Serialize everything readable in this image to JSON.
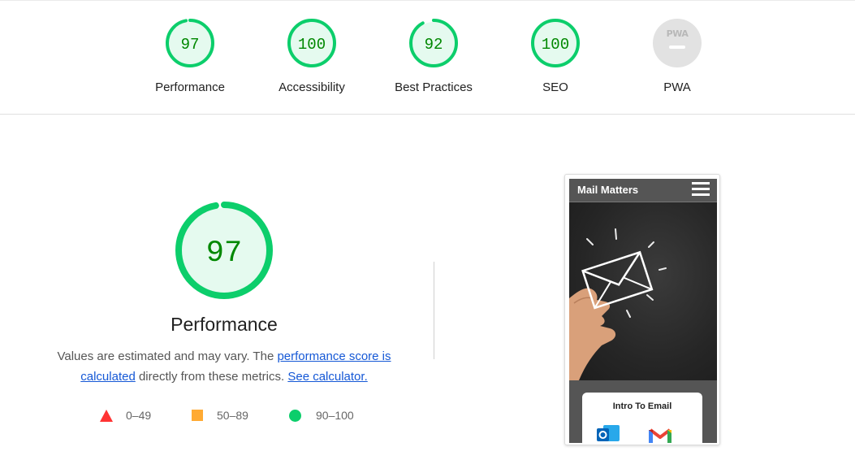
{
  "categories": [
    {
      "label": "Performance",
      "score": "97",
      "score_fraction": 0.97
    },
    {
      "label": "Accessibility",
      "score": "100",
      "score_fraction": 1.0
    },
    {
      "label": "Best Practices",
      "score": "92",
      "score_fraction": 0.92
    },
    {
      "label": "SEO",
      "score": "100",
      "score_fraction": 1.0
    },
    {
      "label": "PWA",
      "logo_text": "PWA"
    }
  ],
  "performance": {
    "score": "97",
    "score_fraction": 0.97,
    "title": "Performance",
    "desc_prefix": "Values are estimated and may vary. The ",
    "link_score": "performance score is calculated",
    "desc_middle": " directly from these metrics. ",
    "link_calculator": "See calculator."
  },
  "legend": [
    {
      "range": "0–49",
      "shape": "triangle",
      "color": "#ff3333"
    },
    {
      "range": "50–89",
      "shape": "square",
      "color": "#ffaa33"
    },
    {
      "range": "90–100",
      "shape": "circle",
      "color": "#0cce6b"
    }
  ],
  "screenshot": {
    "brand": "Mail Matters",
    "card_title": "Intro To Email"
  },
  "colors": {
    "pass": "#0cce6b",
    "pass_fill": "#e5faef",
    "pass_text": "#008800",
    "pwa_gray": "#e2e2e2",
    "link": "#1558d6"
  }
}
